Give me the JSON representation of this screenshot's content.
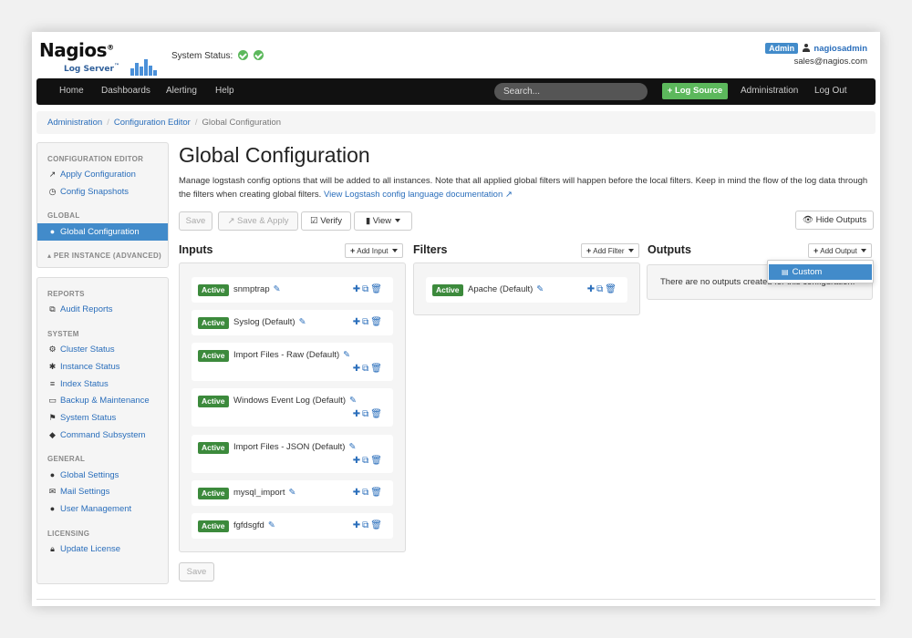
{
  "app": {
    "logo_name": "Nagios",
    "logo_reg": "®",
    "logo_sub": "Log Server",
    "logo_tm": "™",
    "system_status_label": "System Status:"
  },
  "user": {
    "role": "Admin",
    "name": "nagiosadmin",
    "email": "sales@nagios.com"
  },
  "navbar": {
    "items": [
      "Home",
      "Dashboards",
      "Alerting",
      "Help"
    ],
    "search_placeholder": "Search...",
    "log_source_button": "+ Log Source",
    "right_items": [
      "Administration",
      "Log Out"
    ]
  },
  "breadcrumb": {
    "items": [
      "Administration",
      "Configuration Editor"
    ],
    "current": "Global Configuration"
  },
  "sidebar": {
    "config_editor": {
      "heading": "CONFIGURATION EDITOR",
      "items": [
        "Apply Configuration",
        "Config Snapshots"
      ]
    },
    "global": {
      "heading": "GLOBAL",
      "active_item": "Global Configuration"
    },
    "per_instance": "PER INSTANCE (ADVANCED)",
    "reports": {
      "heading": "REPORTS",
      "items": [
        "Audit Reports"
      ]
    },
    "system": {
      "heading": "SYSTEM",
      "items": [
        "Cluster Status",
        "Instance Status",
        "Index Status",
        "Backup & Maintenance",
        "System Status",
        "Command Subsystem"
      ]
    },
    "general": {
      "heading": "GENERAL",
      "items": [
        "Global Settings",
        "Mail Settings",
        "User Management"
      ]
    },
    "licensing": {
      "heading": "LICENSING",
      "items": [
        "Update License"
      ]
    }
  },
  "main": {
    "title": "Global Configuration",
    "description": "Manage logstash config options that will be added to all instances. Note that all applied global filters will happen before the local filters. Keep in mind the flow of the log data through the filters when creating global filters.",
    "doc_link": "View Logstash config language documentation",
    "toolbar": {
      "save": "Save",
      "save_apply": "Save & Apply",
      "verify": "Verify",
      "view": "View",
      "hide_outputs": "Hide Outputs"
    },
    "bottom_save": "Save"
  },
  "inputs": {
    "title": "Inputs",
    "add_label": "Add Input",
    "status": "Active",
    "items": [
      "snmptrap",
      "Syslog (Default)",
      "Import Files - Raw (Default)",
      "Windows Event Log (Default)",
      "Import Files - JSON (Default)",
      "mysql_import",
      "fgfdsgfd"
    ]
  },
  "filters": {
    "title": "Filters",
    "add_label": "Add Filter",
    "status": "Active",
    "items": [
      "Apache (Default)"
    ]
  },
  "outputs": {
    "title": "Outputs",
    "add_label": "Add Output",
    "empty_message": "There are no outputs created for this configuration.",
    "dropdown_items": [
      "Custom"
    ]
  },
  "colors": {
    "primary": "#428bca",
    "link": "#2a6ebb",
    "success": "#5cb85c",
    "active_badge": "#3c8a3c",
    "navbar": "#111111"
  }
}
